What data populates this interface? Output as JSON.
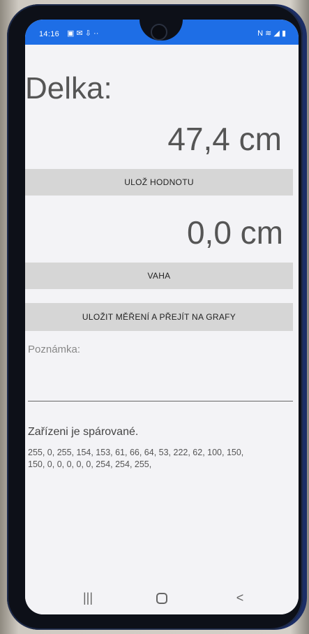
{
  "status_bar": {
    "time": "14:16",
    "left_icons": [
      "gallery-icon",
      "notification-icon",
      "download-icon",
      "more-icon"
    ],
    "right_icons": [
      "nfc-icon",
      "wifi-icon",
      "signal-icon",
      "battery-icon"
    ]
  },
  "app": {
    "title": "Delka:",
    "length_value": "47,4 cm",
    "save_button": "ULOŽ HODNOTU",
    "weight_value": "0,0 cm",
    "weight_button": "VAHA",
    "save_and_graph_button": "ULOŽIT MĚŘENÍ A PŘEJÍT NA GRAFY",
    "note_placeholder": "Poznámka:",
    "device_status": "Zařízeni je spárované.",
    "bytes_line1": "255, 0, 255, 154, 153, 61, 66, 64, 53, 222, 62, 100, 150,",
    "bytes_line2": "150, 0, 0, 0, 0, 0, 254, 254, 255,"
  },
  "navigation": {
    "recent_label": "|||",
    "home_label": "",
    "back_label": "<"
  }
}
